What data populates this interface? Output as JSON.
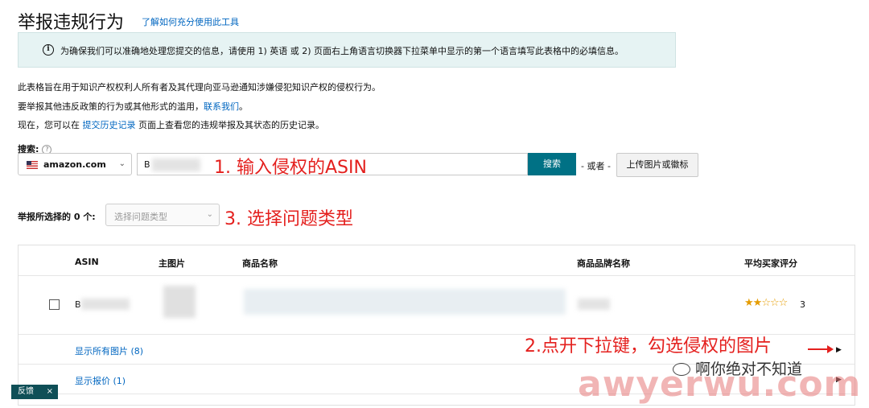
{
  "header": {
    "title": "举报违规行为",
    "help_link": "了解如何充分使用此工具"
  },
  "info_banner": {
    "text": "为确保我们可以准确地处理您提交的信息，请使用 1) 英语 或 2) 页面右上角语言切换器下拉菜单中显示的第一个语言填写此表格中的必填信息。"
  },
  "description": {
    "line1": "此表格旨在用于知识产权权利人所有者及其代理向亚马逊通知涉嫌侵犯知识产权的侵权行为。",
    "line2_prefix": "要举报其他违反政策的行为或其他形式的滥用，",
    "line2_link": "联系我们",
    "line2_suffix": "。",
    "line3_prefix": "现在，您可以在",
    "line3_link": "提交历史记录",
    "line3_suffix": "页面上查看您的违规举报及其状态的历史记录。"
  },
  "search": {
    "label": "搜索:",
    "help_icon": "?",
    "marketplace": "amazon.com",
    "input_prefix": "B",
    "button_label": "搜索",
    "or_text": "- 或者 -",
    "upload_label": "上传图片或徽标"
  },
  "issue": {
    "label": "举报所选择的 0 个:",
    "placeholder": "选择问题类型"
  },
  "table": {
    "columns": [
      "ASIN",
      "主图片",
      "商品名称",
      "商品品牌名称",
      "平均买家评分"
    ],
    "row": {
      "asin_prefix": "B",
      "rating_stars": 2,
      "rating_max": 5,
      "rating_count": "3"
    },
    "show_all_images": "显示所有图片 (8)",
    "show_offers": "显示报价 (1)"
  },
  "annotations": {
    "step1": "1. 输入侵权的ASIN",
    "step2": "2.点开下拉键，勾选侵权的图片",
    "step3": "3. 选择问题类型"
  },
  "feedback": {
    "label": "反馈",
    "close": "×"
  },
  "watermark": {
    "account": "啊你绝对不知道",
    "site": "awyerwu.com"
  },
  "colors": {
    "link": "#0066c0",
    "primary_button": "#007185",
    "annotation": "#e4201e",
    "star": "#e59c00"
  }
}
